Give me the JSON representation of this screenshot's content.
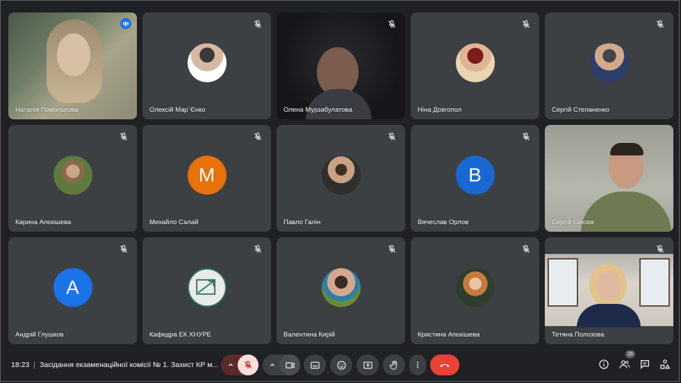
{
  "participants": [
    {
      "name": "Наталія Помогалова"
    },
    {
      "name": "Олексій Мар`Єнко"
    },
    {
      "name": "Олена Мурзабулатова"
    },
    {
      "name": "Ніна Довгопол"
    },
    {
      "name": "Сергій Степаненко"
    },
    {
      "name": "Карина Апєкішева"
    },
    {
      "name": "Михайло Салай",
      "initial": "M"
    },
    {
      "name": "Павло Галін"
    },
    {
      "name": "Вячеслав Орлов",
      "initial": "B"
    },
    {
      "name": "Сергій Сюсюк"
    },
    {
      "name": "Андрій Глушков",
      "initial": "A"
    },
    {
      "name": "Кафедра ЕК ХНУРЕ"
    },
    {
      "name": "Валентина Кирій"
    },
    {
      "name": "Кристина Апєкішева"
    },
    {
      "name": "Тетяна Полозова"
    }
  ],
  "meeting": {
    "time": "18:23",
    "title": "Засідання екзаменаційної комісії № 1. Захист КР м..."
  },
  "people_count": "15",
  "colors": {
    "background": "#202124",
    "tile": "#3c4043",
    "mic_muted_red": "#f28b82",
    "end_call": "#ea4335",
    "avatar_orange": "#e8710a",
    "avatar_blue": "#1967d2"
  },
  "icons": [
    "mic-off-icon",
    "chevron-up-icon",
    "camera-icon",
    "captions-icon",
    "emoji-icon",
    "present-icon",
    "raise-hand-icon",
    "more-options-icon",
    "end-call-icon",
    "info-icon",
    "people-icon",
    "chat-icon",
    "activities-icon"
  ]
}
